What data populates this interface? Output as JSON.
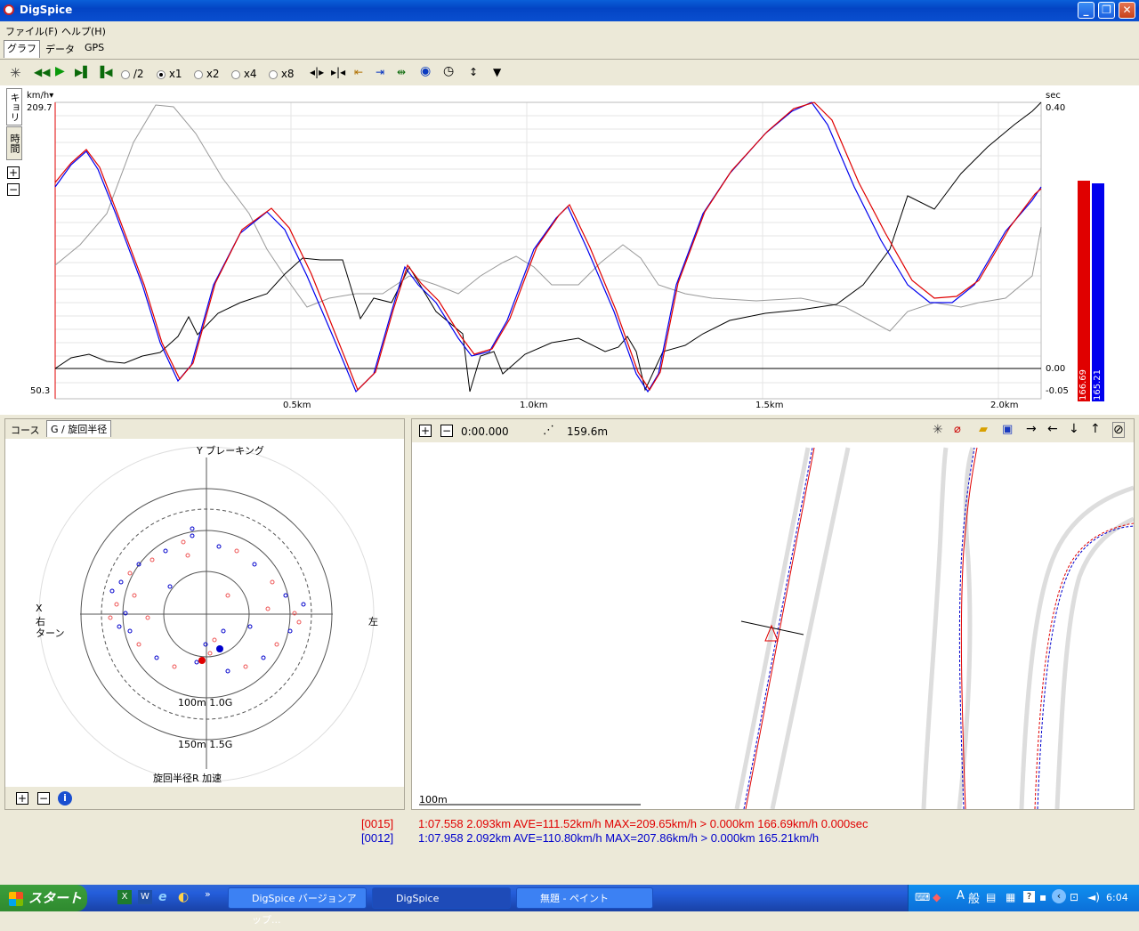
{
  "window": {
    "title": "DigSpice"
  },
  "menu": {
    "file": "ファイル(F)",
    "help": "ヘルプ(H)"
  },
  "tabs": {
    "graph": "グラフ",
    "data": "データ",
    "gps": "GPS"
  },
  "toolbar": {
    "half": "/2",
    "x1": "x1",
    "x2": "x2",
    "x4": "x4",
    "x8": "x8",
    "selected_speed": "x1"
  },
  "graph": {
    "left_unit": "km/h▾",
    "right_unit": "sec",
    "y_max": "209.7",
    "y_min": "50.3",
    "right_top": "0.40",
    "right_zero": "0.00",
    "right_bottom": "-0.05",
    "x_ticks": [
      "0.5km",
      "1.0km",
      "1.5km",
      "2.0km"
    ],
    "side_tab_distance": "キョリ",
    "side_tab_time": "時間",
    "bar_red_value": "166.69",
    "bar_blue_value": "165.21"
  },
  "gpanel": {
    "tab_course": "コース",
    "tab_g": "G / 旋回半径",
    "top_label": "Y ブレーキング",
    "x_label": "X",
    "right_label": "右",
    "turn_label": "ターン",
    "left_label": "左",
    "ring1": "100m 1.0G",
    "ring2": "150m 1.5G",
    "bottom_label": "旋回半径R 加速"
  },
  "course": {
    "time": "0:00.000",
    "distance": "159.6m",
    "scale_label": "100m"
  },
  "status": {
    "red_id": "[0015]",
    "blue_id": "[0012]",
    "red_text": "1:07.558 2.093km AVE=111.52km/h MAX=209.65km/h > 0.000km 166.69km/h 0.000sec",
    "blue_text": "1:07.958 2.092km AVE=110.80km/h MAX=207.86km/h > 0.000km 165.21km/h"
  },
  "taskbar": {
    "start": "スタート",
    "task1": "DigSpice バージョンアップ...",
    "task2": "DigSpice",
    "task3": "無題 - ペイント",
    "clock": "6:04"
  },
  "colors": {
    "lap_red": "#e00000",
    "lap_blue": "#0000cc",
    "ref_gray": "#999999"
  }
}
